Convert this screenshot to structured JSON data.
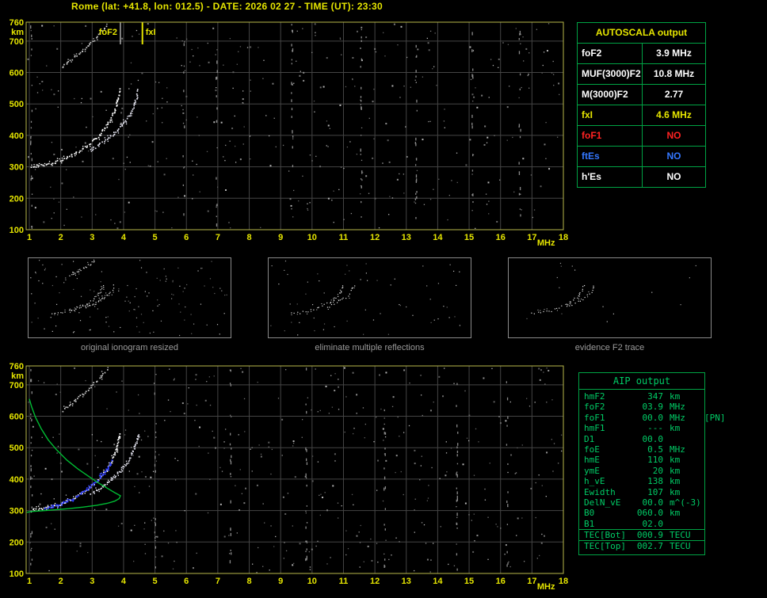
{
  "header": {
    "title": "Rome (lat: +41.8, lon: 012.5) - DATE: 2026 02 27 - TIME (UT): 23:30"
  },
  "colors": {
    "yellow": "#e6e600",
    "plot_border": "#b9b94a",
    "grid": "#454545",
    "green_border": "#00a344",
    "green_text": "#00cc66",
    "red": "#ff2222",
    "blue": "#3377ff",
    "white": "#ffffff",
    "profile_green": "#00bb33",
    "restored_blue": "#2b3bff",
    "caption_gray": "#9a9a9a"
  },
  "autoscala": {
    "title": "AUTOSCALA output",
    "rows": [
      {
        "label": "foF2",
        "value": "3.9 MHz",
        "color": "#ffffff"
      },
      {
        "label": "MUF(3000)F2",
        "value": "10.8 MHz",
        "color": "#ffffff"
      },
      {
        "label": "M(3000)F2",
        "value": "2.77",
        "color": "#ffffff"
      },
      {
        "label": "fxI",
        "value": "4.6 MHz",
        "color": "#e6e600"
      },
      {
        "label": "foF1",
        "value": "NO",
        "color": "#ff2222"
      },
      {
        "label": "ftEs",
        "value": "NO",
        "color": "#3377ff"
      },
      {
        "label": "h'Es",
        "value": "NO",
        "color": "#ffffff"
      }
    ]
  },
  "thumbnails": [
    {
      "caption": "original ionogram resized"
    },
    {
      "caption": "eliminate multiple reflections"
    },
    {
      "caption": "evidence F2 trace"
    }
  ],
  "aip": {
    "title": "AIP output",
    "rows": [
      {
        "name": "hmF2",
        "value": "347",
        "unit": "km"
      },
      {
        "name": "foF2",
        "value": "03.9",
        "unit": "MHz"
      },
      {
        "name": "foF1",
        "value": "00.0",
        "unit": "MHz",
        "extra": "[PN]"
      },
      {
        "name": "hmF1",
        "value": "---",
        "unit": "km"
      },
      {
        "name": "D1",
        "value": "00.0",
        "unit": ""
      },
      {
        "name": "foE",
        "value": "0.5",
        "unit": "MHz"
      },
      {
        "name": "hmE",
        "value": "110",
        "unit": "km"
      },
      {
        "name": "ymE",
        "value": "20",
        "unit": "km"
      },
      {
        "name": "h_vE",
        "value": "138",
        "unit": "km"
      },
      {
        "name": "Ewidth",
        "value": "107",
        "unit": "km"
      },
      {
        "name": "DelN_vE",
        "value": "00.0",
        "unit": "m^(-3)"
      },
      {
        "name": "B0",
        "value": "060.0",
        "unit": "km"
      },
      {
        "name": "B1",
        "value": "02.0",
        "unit": ""
      },
      {
        "name": "TEC[Bot]",
        "value": "000.9",
        "unit": "TECU",
        "sep": true
      },
      {
        "name": "TEC[Top]",
        "value": "002.7",
        "unit": "TECU",
        "sep": true
      }
    ]
  },
  "chart_data": [
    {
      "id": "main_ionogram",
      "type": "scatter",
      "title": "ionogram (autoscaled)",
      "xlabel": "MHz",
      "ylabel": "km",
      "xlim": [
        1,
        18
      ],
      "ylim": [
        100,
        760
      ],
      "grid": true,
      "x_ticks": [
        1,
        2,
        3,
        4,
        5,
        6,
        7,
        8,
        9,
        10,
        11,
        12,
        13,
        14,
        15,
        16,
        17,
        18
      ],
      "y_ticks": [
        760,
        700,
        600,
        500,
        400,
        300,
        200,
        100
      ],
      "annotations": [
        {
          "label": "foF2",
          "freq_mhz": 3.9,
          "color": "#ffffff"
        },
        {
          "label": "fxI",
          "freq_mhz": 4.6,
          "color": "#e6e600"
        }
      ],
      "series": [
        {
          "name": "F2 trace (ordinary)",
          "style": "scatter",
          "color": "#ffffff",
          "points": [
            [
              1.05,
              302
            ],
            [
              1.2,
              304
            ],
            [
              1.35,
              306
            ],
            [
              1.5,
              309
            ],
            [
              1.65,
              312
            ],
            [
              1.8,
              316
            ],
            [
              1.95,
              321
            ],
            [
              2.1,
              327
            ],
            [
              2.25,
              334
            ],
            [
              2.4,
              342
            ],
            [
              2.55,
              351
            ],
            [
              2.7,
              360
            ],
            [
              2.85,
              370
            ],
            [
              3.0,
              382
            ],
            [
              3.1,
              392
            ],
            [
              3.2,
              402
            ],
            [
              3.3,
              413
            ],
            [
              3.4,
              426
            ],
            [
              3.5,
              440
            ],
            [
              3.58,
              454
            ],
            [
              3.65,
              468
            ],
            [
              3.71,
              482
            ],
            [
              3.76,
              497
            ],
            [
              3.8,
              512
            ],
            [
              3.84,
              527
            ],
            [
              3.87,
              541
            ],
            [
              3.89,
              553
            ]
          ]
        },
        {
          "name": "F2 trace (extraordinary)",
          "style": "scatter",
          "color": "#e6e6f2",
          "points": [
            [
              2.95,
              355
            ],
            [
              3.1,
              364
            ],
            [
              3.25,
              374
            ],
            [
              3.4,
              385
            ],
            [
              3.55,
              397
            ],
            [
              3.7,
              410
            ],
            [
              3.85,
              424
            ],
            [
              3.98,
              439
            ],
            [
              4.1,
              455
            ],
            [
              4.2,
              471
            ],
            [
              4.28,
              487
            ],
            [
              4.34,
              503
            ],
            [
              4.39,
              519
            ],
            [
              4.43,
              536
            ],
            [
              4.46,
              551
            ]
          ]
        },
        {
          "name": "second reflection (multiple)",
          "style": "scatter",
          "color": "#c8c8c8",
          "step": 3,
          "points": [
            [
              2.05,
              620
            ],
            [
              2.2,
              632
            ],
            [
              2.35,
              645
            ],
            [
              2.5,
              657
            ],
            [
              2.65,
              669
            ],
            [
              2.8,
              682
            ],
            [
              2.95,
              696
            ],
            [
              3.1,
              711
            ],
            [
              3.25,
              727
            ],
            [
              3.4,
              744
            ],
            [
              3.5,
              757
            ]
          ]
        }
      ]
    },
    {
      "id": "profile_ionogram",
      "type": "scatter",
      "title": "ionogram with restored trace and electron density profile",
      "xlabel": "MHz",
      "ylabel": "km",
      "xlim": [
        1,
        18
      ],
      "ylim": [
        100,
        760
      ],
      "grid": true,
      "x_ticks": [
        1,
        2,
        3,
        4,
        5,
        6,
        7,
        8,
        9,
        10,
        11,
        12,
        13,
        14,
        15,
        16,
        17,
        18
      ],
      "y_ticks": [
        760,
        700,
        600,
        500,
        400,
        300,
        200,
        100
      ],
      "includes_traces_of": "main_ionogram",
      "series": [
        {
          "name": "restored F2 trace",
          "style": "scatter",
          "color": "#2b3bff",
          "dot": 2,
          "points": [
            [
              1.5,
              309
            ],
            [
              1.7,
              314
            ],
            [
              1.9,
              320
            ],
            [
              2.1,
              327
            ],
            [
              2.3,
              336
            ],
            [
              2.5,
              347
            ],
            [
              2.7,
              360
            ],
            [
              2.9,
              375
            ],
            [
              3.1,
              392
            ],
            [
              3.3,
              413
            ],
            [
              3.45,
              433
            ],
            [
              3.55,
              450
            ],
            [
              3.63,
              465
            ]
          ]
        },
        {
          "name": "electron density profile (hmF2 347 km, foF2 3.9 MHz)",
          "style": "line",
          "color": "#00bb33",
          "points": [
            [
              1.0,
              655
            ],
            [
              1.08,
              628
            ],
            [
              1.2,
              596
            ],
            [
              1.38,
              560
            ],
            [
              1.6,
              525
            ],
            [
              1.88,
              492
            ],
            [
              2.2,
              460
            ],
            [
              2.55,
              432
            ],
            [
              2.9,
              408
            ],
            [
              3.2,
              388
            ],
            [
              3.5,
              370
            ],
            [
              3.72,
              357
            ],
            [
              3.87,
              349
            ],
            [
              3.9,
              347
            ],
            [
              3.86,
              338
            ],
            [
              3.72,
              330
            ],
            [
              3.48,
              323
            ],
            [
              3.15,
              317
            ],
            [
              2.72,
              311
            ],
            [
              2.25,
              306
            ],
            [
              1.75,
              302
            ],
            [
              1.35,
              299
            ],
            [
              1.05,
              297
            ],
            [
              0.92,
              294
            ]
          ]
        }
      ]
    }
  ]
}
